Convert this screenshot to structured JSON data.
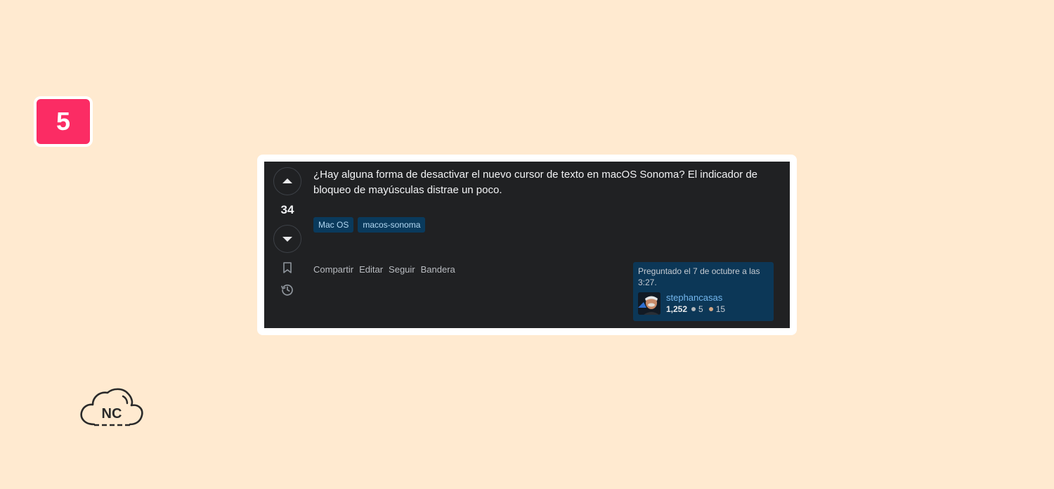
{
  "step": {
    "number": "5"
  },
  "post": {
    "vote_count": "34",
    "question_text": "¿Hay alguna forma de desactivar el nuevo cursor de texto en macOS Sonoma? El indicador de bloqueo de mayúsculas distrae un poco.",
    "tags": [
      "Mac OS",
      "macos-sonoma"
    ],
    "actions": [
      "Compartir",
      "Editar",
      "Seguir",
      "Bandera"
    ],
    "owner": {
      "asked_text": "Preguntado el 7 de octubre a las 3:27.",
      "username": "stephancasas",
      "reputation": "1,252",
      "silver_badges": "5",
      "bronze_badges": "15"
    }
  },
  "icons": {
    "upvote": "arrow-up-icon",
    "downvote": "arrow-down-icon",
    "bookmark": "bookmark-icon",
    "history": "history-icon"
  },
  "colors": {
    "background": "#ffead0",
    "badge": "#fb2c64",
    "card": "#202123",
    "tag_bg": "#0a3a5c",
    "tag_text": "#b3d9f3",
    "owner_bg": "#0c3757",
    "link": "#74b7ee",
    "silver": "#b4b8bc",
    "bronze": "#d1a684"
  },
  "logo": {
    "text": "NC"
  }
}
